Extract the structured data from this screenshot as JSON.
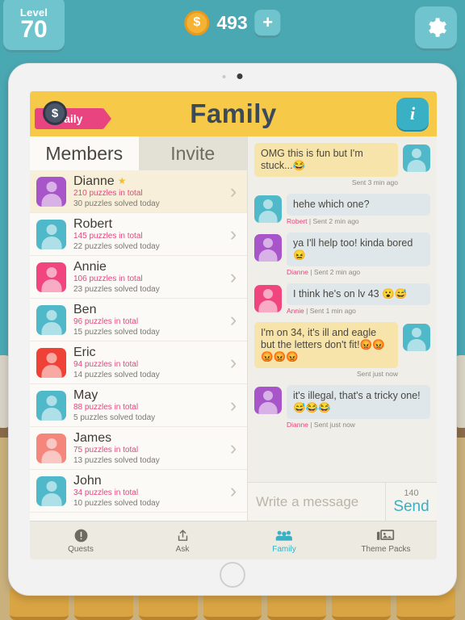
{
  "hud": {
    "level_word": "Level",
    "level_number": "70",
    "coins": "493",
    "plus_label": "+",
    "coin_glyph": "$",
    "gear_icon": "gear-icon"
  },
  "header": {
    "title": "Family",
    "daily_label": "Daily",
    "daily_coin_glyph": "$",
    "info_label": "i"
  },
  "tabs": [
    {
      "label": "Members",
      "active": true
    },
    {
      "label": "Invite",
      "active": false
    }
  ],
  "members": [
    {
      "name": "Dianne",
      "total": "210 puzzles in total",
      "today": "30 puzzles solved today",
      "color": "#a855c9",
      "star": true,
      "highlight": true
    },
    {
      "name": "Robert",
      "total": "145 puzzles in total",
      "today": "22 puzzles solved today",
      "color": "#4fb9c9",
      "star": false,
      "highlight": false
    },
    {
      "name": "Annie",
      "total": "106 puzzles in total",
      "today": "23 puzzles solved today",
      "color": "#f0457e",
      "star": false,
      "highlight": false
    },
    {
      "name": "Ben",
      "total": "96 puzzles in total",
      "today": "15 puzzles solved today",
      "color": "#4fb9c9",
      "star": false,
      "highlight": false
    },
    {
      "name": "Eric",
      "total": "94 puzzles in total",
      "today": "14 puzzles solved today",
      "color": "#ef4136",
      "star": false,
      "highlight": false
    },
    {
      "name": "May",
      "total": "88 puzzles in total",
      "today": "5 puzzles solved today",
      "color": "#4fb9c9",
      "star": false,
      "highlight": false
    },
    {
      "name": "James",
      "total": "75 puzzles in total",
      "today": "13 puzzles solved today",
      "color": "#f4867c",
      "star": false,
      "highlight": false
    },
    {
      "name": "John",
      "total": "34 puzzles in total",
      "today": "10 puzzles solved today",
      "color": "#4fb9c9",
      "star": false,
      "highlight": false
    }
  ],
  "chat": {
    "messages": [
      {
        "side": "self",
        "text": "OMG this is fun but I'm stuck...😂",
        "who": "",
        "sep": "",
        "time": "Sent 3 min ago",
        "color": "#4fb9c9"
      },
      {
        "side": "other",
        "text": "hehe which one?",
        "who": "Robert",
        "sep": "|",
        "time": "Sent 2 min ago",
        "color": "#4fb9c9"
      },
      {
        "side": "other",
        "text": "ya I'll help too! kinda bored 😖",
        "who": "Dianne",
        "sep": "|",
        "time": "Sent 2 min ago",
        "color": "#a855c9"
      },
      {
        "side": "other",
        "text": "I think he's on lv 43 😮😅",
        "who": "Annie",
        "sep": "|",
        "time": "Sent 1 min ago",
        "color": "#f0457e"
      },
      {
        "side": "self",
        "text": "I'm on 34, it's ill and eagle but the letters don't fit!😡😡😡😡😡",
        "who": "",
        "sep": "",
        "time": "Sent just now",
        "color": "#4fb9c9"
      },
      {
        "side": "other",
        "text": "it's illegal, that's a tricky one!😅😂😂",
        "who": "Dianne",
        "sep": "|",
        "time": "Sent just now",
        "color": "#a855c9"
      }
    ],
    "composer_placeholder": "Write a message",
    "char_count": "140",
    "send_label": "Send"
  },
  "bottom_nav": [
    {
      "label": "Quests",
      "icon": "exclamation-icon",
      "active": false
    },
    {
      "label": "Ask",
      "icon": "share-icon",
      "active": false
    },
    {
      "label": "Family",
      "icon": "people-icon",
      "active": true
    },
    {
      "label": "Theme Packs",
      "icon": "image-icon",
      "active": false
    }
  ]
}
